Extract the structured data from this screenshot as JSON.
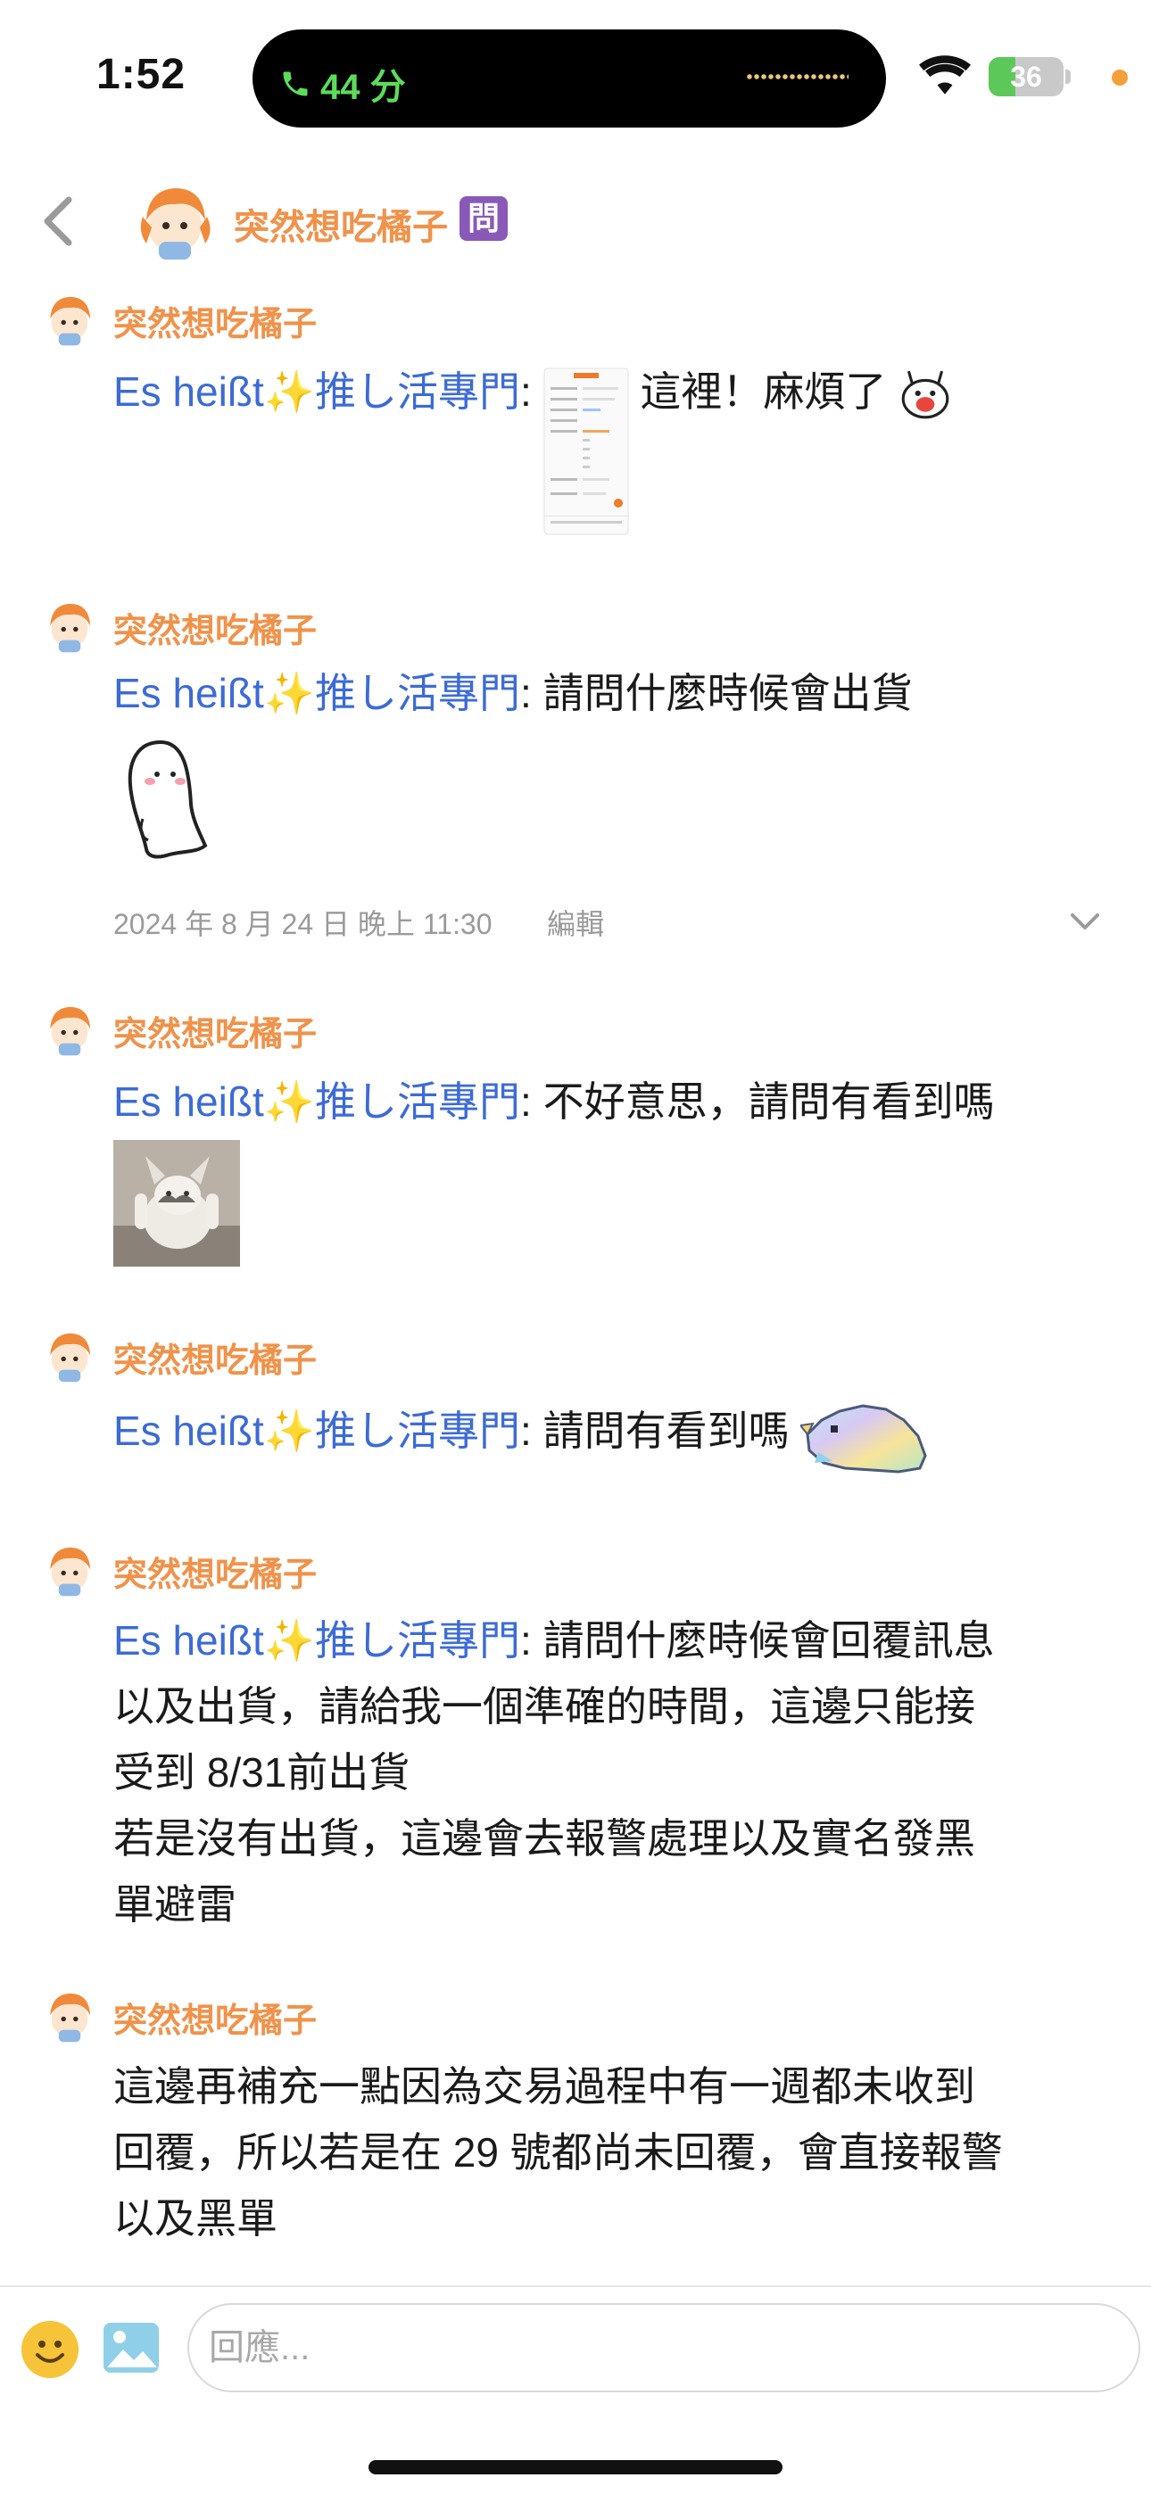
{
  "status_bar": {
    "time": "1:52",
    "call_duration": "44 分",
    "battery_level": "36",
    "battery_fraction": 0.36
  },
  "header": {
    "title": "突然想吃橘子",
    "badge": "問"
  },
  "messages": [
    {
      "author": "突然想吃橘子",
      "mention": "Es heißt",
      "mention_suffix": "推し活專門",
      "colon": ":",
      "text": " 這裡！麻煩了"
    },
    {
      "author": "突然想吃橘子",
      "mention": "Es heißt",
      "mention_suffix": "推し活專門",
      "colon": ":",
      "text": " 請問什麼時候會出貨",
      "timestamp": "2024 年 8 月 24 日 晚上 11:30",
      "edit_label": "編輯"
    },
    {
      "author": "突然想吃橘子",
      "mention": "Es heißt",
      "mention_suffix": "推し活專門",
      "colon": ":",
      "text": " 不好意思，請問有看到嗎"
    },
    {
      "author": "突然想吃橘子",
      "mention": "Es heißt",
      "mention_suffix": "推し活專門",
      "colon": ":",
      "text": " 請問有看到嗎"
    },
    {
      "author": "突然想吃橘子",
      "mention": "Es heißt",
      "mention_suffix": "推し活專門",
      "colon": ":",
      "line1": " 請問什麼時候會回覆訊息",
      "line2": "以及出貨，請給我一個準確的時間，這邊只能接",
      "line3": "受到 8/31前出貨",
      "line4": "若是沒有出貨，這邊會去報警處理以及實名發黑",
      "line5": "單避雷"
    },
    {
      "author": "突然想吃橘子",
      "line1": "這邊再補充一點因為交易過程中有一週都未收到",
      "line2": "回覆，所以若是在 29 號都尚未回覆，會直接報警",
      "line3": "以及黑單"
    }
  ],
  "composer": {
    "placeholder": "回應..."
  },
  "icons": {
    "back": "chevron-left-icon",
    "phone": "phone-icon",
    "wifi": "wifi-icon",
    "battery": "battery-charging-icon",
    "emoji": "smiley-icon",
    "image": "image-icon",
    "expand": "chevron-down-icon"
  },
  "colors": {
    "author": "#f0924a",
    "mention": "#3c6bd6",
    "badge": "#8a59b8",
    "call": "#5ddc5a"
  }
}
